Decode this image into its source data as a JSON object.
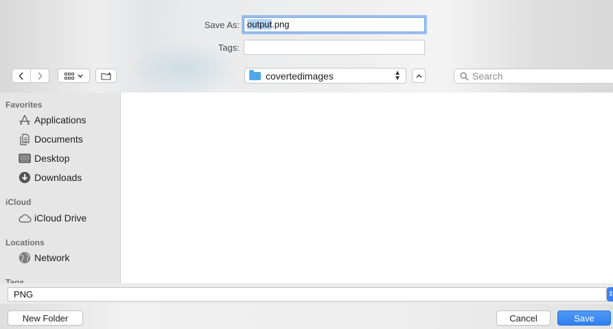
{
  "save_as": {
    "label": "Save As:",
    "value_selected": "output",
    "value_rest": ".png"
  },
  "tags": {
    "label": "Tags:",
    "value": ""
  },
  "toolbar": {
    "current_folder": "covertedimages",
    "search_placeholder": "Search"
  },
  "sidebar": {
    "favorites_heading": "Favorites",
    "favorites": [
      {
        "label": "Applications",
        "icon": "applications-icon"
      },
      {
        "label": "Documents",
        "icon": "documents-icon"
      },
      {
        "label": "Desktop",
        "icon": "desktop-icon"
      },
      {
        "label": "Downloads",
        "icon": "downloads-icon"
      }
    ],
    "icloud_heading": "iCloud",
    "icloud": [
      {
        "label": "iCloud Drive",
        "icon": "cloud-icon"
      }
    ],
    "locations_heading": "Locations",
    "locations": [
      {
        "label": "Network",
        "icon": "globe-icon"
      }
    ],
    "tags_heading": "Tags"
  },
  "format": {
    "value": "PNG"
  },
  "buttons": {
    "new_folder": "New Folder",
    "cancel": "Cancel",
    "save": "Save"
  },
  "colors": {
    "accent": "#3b82f6",
    "folder": "#4fa8e8",
    "sidebar_bg": "#e6e6e6"
  }
}
